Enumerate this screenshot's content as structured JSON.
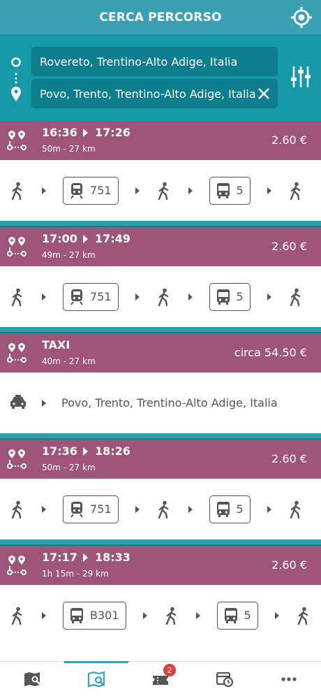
{
  "appbar": {
    "title": "CERCA PERCORSO",
    "gps_icon": "gps-target-icon"
  },
  "search": {
    "from_value": "Rovereto, Trentino-Alto Adige, Italia",
    "to_value": "Povo, Trento, Trentino-Alto Adige, Italia",
    "clear_icon": "close-icon",
    "filters_icon": "sliders-icon"
  },
  "routes": [
    {
      "type": "transit",
      "depart": "16:36",
      "arrive": "17:26",
      "meta": "50m - 27 km",
      "price": "2.60 €",
      "legs": [
        {
          "kind": "walk"
        },
        {
          "kind": "train",
          "line": "751"
        },
        {
          "kind": "walk"
        },
        {
          "kind": "bus",
          "line": "5"
        },
        {
          "kind": "walk"
        }
      ]
    },
    {
      "type": "transit",
      "depart": "17:00",
      "arrive": "17:49",
      "meta": "49m - 27 km",
      "price": "2.60 €",
      "legs": [
        {
          "kind": "walk"
        },
        {
          "kind": "train",
          "line": "751"
        },
        {
          "kind": "walk"
        },
        {
          "kind": "bus",
          "line": "5"
        },
        {
          "kind": "walk"
        }
      ]
    },
    {
      "type": "taxi",
      "label": "TAXI",
      "meta": "40m - 27 km",
      "price": "circa 54.50 €",
      "destination": "Povo, Trento, Trentino-Alto Adige, Italia"
    },
    {
      "type": "transit",
      "depart": "17:36",
      "arrive": "18:26",
      "meta": "50m - 27 km",
      "price": "2.60 €",
      "legs": [
        {
          "kind": "walk"
        },
        {
          "kind": "train",
          "line": "751"
        },
        {
          "kind": "walk"
        },
        {
          "kind": "bus",
          "line": "5"
        },
        {
          "kind": "walk"
        }
      ]
    },
    {
      "type": "transit",
      "depart": "17:17",
      "arrive": "18:33",
      "meta": "1h 15m - 29 km",
      "price": "2.60 €",
      "legs": [
        {
          "kind": "walk"
        },
        {
          "kind": "bus",
          "line": "B301"
        },
        {
          "kind": "walk"
        },
        {
          "kind": "bus",
          "line": "5"
        },
        {
          "kind": "walk"
        }
      ]
    }
  ],
  "bottom_nav": {
    "tabs": [
      {
        "icon": "map-search-icon",
        "active": false
      },
      {
        "icon": "route-search-icon",
        "active": true
      },
      {
        "icon": "tickets-icon",
        "active": false,
        "badge": "2"
      },
      {
        "icon": "timetable-icon",
        "active": false
      },
      {
        "icon": "more-icon",
        "active": false
      }
    ]
  },
  "colors": {
    "appbar": "#3aa0b4",
    "search_panel": "#1598a8",
    "field": "#0c7e8d",
    "route_header": "#9e5579",
    "badge": "#e23b3b"
  }
}
